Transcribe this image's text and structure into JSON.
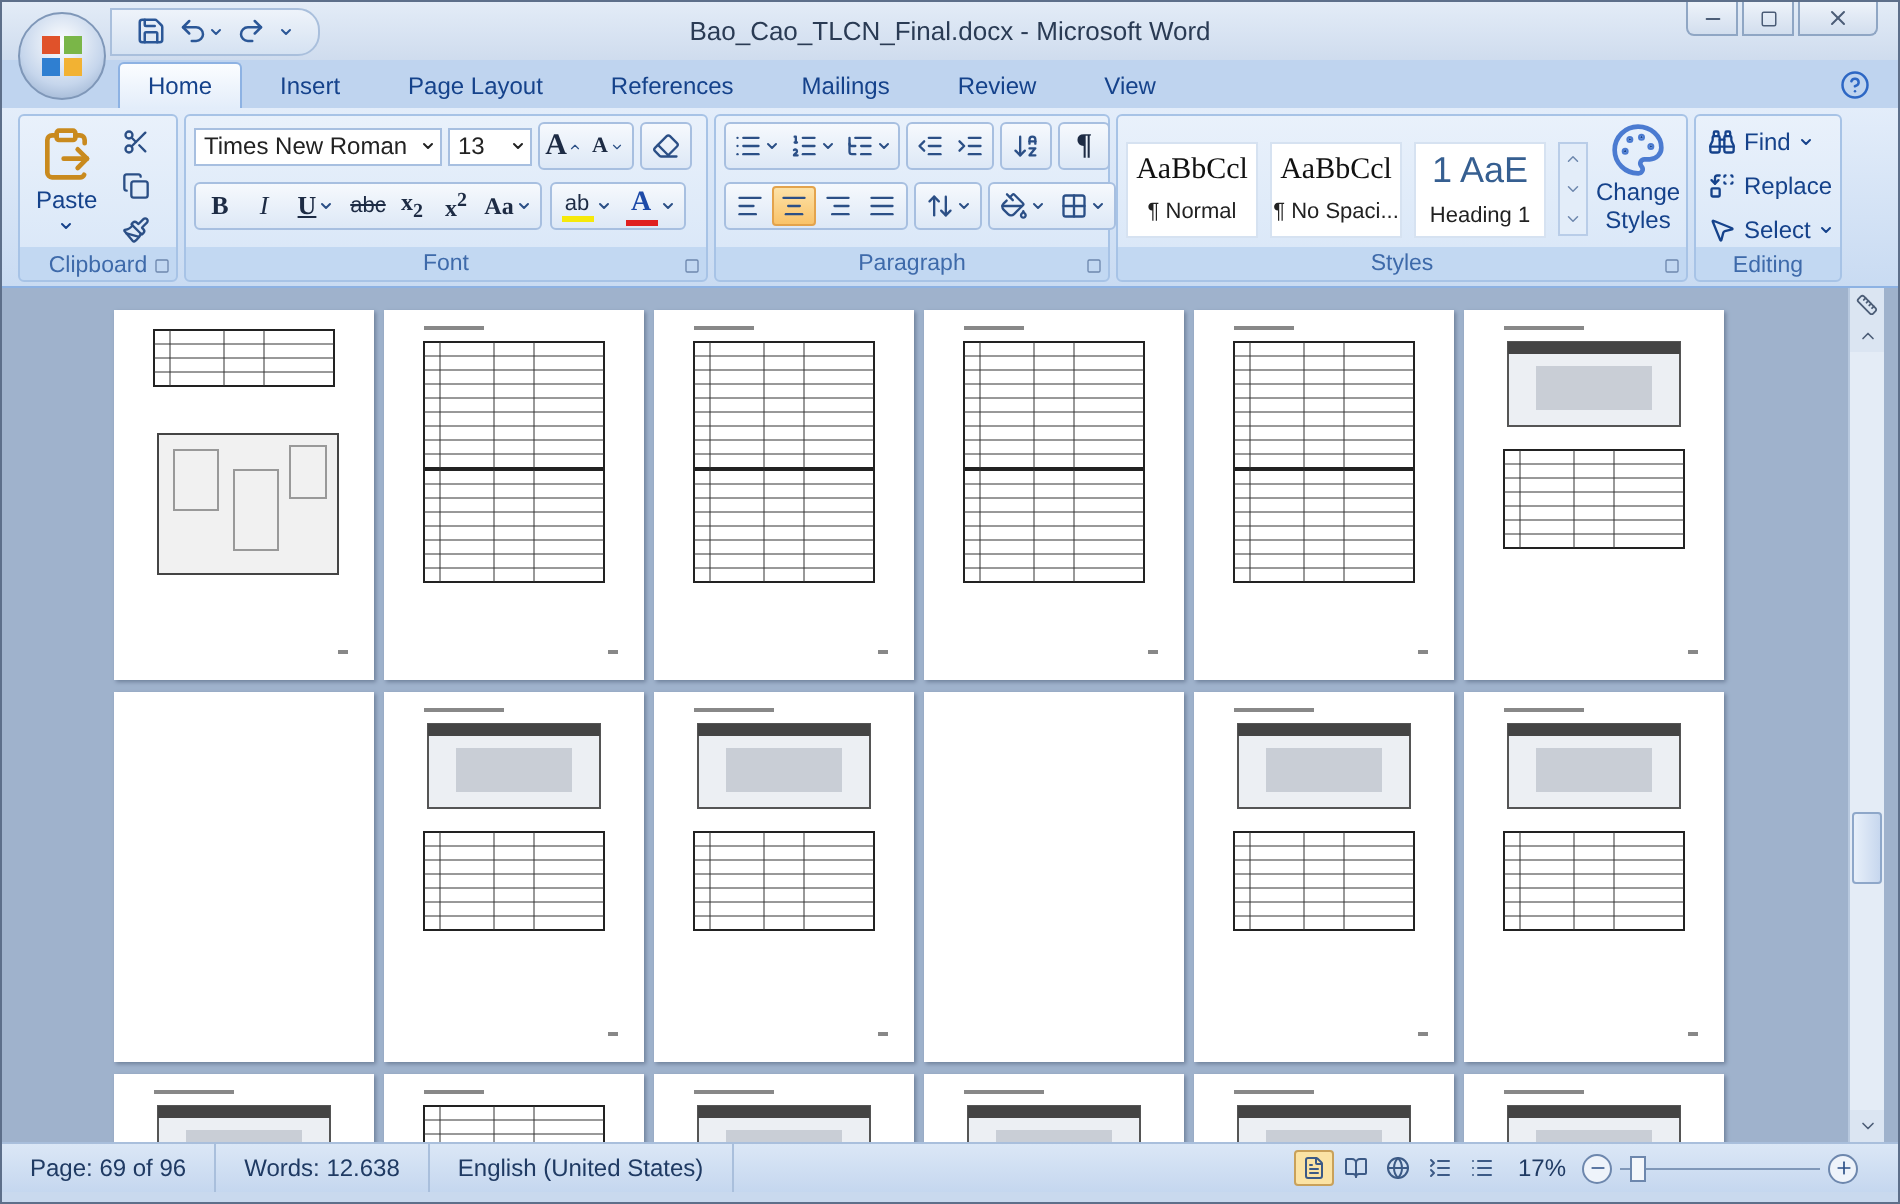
{
  "window": {
    "title": "Bao_Cao_TLCN_Final.docx - Microsoft Word"
  },
  "tabs": [
    {
      "label": "Home",
      "selected": true
    },
    {
      "label": "Insert",
      "selected": false
    },
    {
      "label": "Page Layout",
      "selected": false
    },
    {
      "label": "References",
      "selected": false
    },
    {
      "label": "Mailings",
      "selected": false
    },
    {
      "label": "Review",
      "selected": false
    },
    {
      "label": "View",
      "selected": false
    }
  ],
  "clipboard": {
    "group_label": "Clipboard",
    "paste_label": "Paste"
  },
  "font": {
    "group_label": "Font",
    "font_name": "Times New Roman",
    "font_size": "13",
    "grow_label": "A",
    "shrink_label": "A",
    "highlight_label": "ab",
    "color_label": "A",
    "format_buttons": [
      {
        "kind": "bold",
        "label": "B",
        "dropdown": false
      },
      {
        "kind": "italic",
        "label": "I",
        "dropdown": false
      },
      {
        "kind": "underline",
        "label": "U",
        "dropdown": true
      },
      {
        "kind": "strike",
        "label": "abc",
        "dropdown": false
      },
      {
        "kind": "plain",
        "label": "x$_{2}$",
        "dropdown": false
      },
      {
        "kind": "plain",
        "label": "x$^{2}$",
        "dropdown": false
      },
      {
        "kind": "plain",
        "label": "Aa",
        "dropdown": true
      }
    ]
  },
  "paragraph": {
    "group_label": "Paragraph",
    "show_marks_label": "¶",
    "alignments": [
      {
        "kind": "left",
        "selected": false
      },
      {
        "kind": "center",
        "selected": true
      },
      {
        "kind": "right",
        "selected": false
      },
      {
        "kind": "justify",
        "selected": false
      }
    ]
  },
  "styles": {
    "group_label": "Styles",
    "change_label": "Change Styles",
    "items": [
      {
        "kind": "body",
        "preview": "AaBbCcl",
        "name": "¶ Normal"
      },
      {
        "kind": "body",
        "preview": "AaBbCcl",
        "name": "¶ No Spaci..."
      },
      {
        "kind": "heading",
        "preview": "1  AaE",
        "name": "Heading 1"
      }
    ]
  },
  "editing": {
    "group_label": "Editing",
    "items": [
      {
        "kind": "find",
        "label": "Find",
        "dropdown": true
      },
      {
        "kind": "replace",
        "label": "Replace",
        "dropdown": false
      },
      {
        "kind": "select",
        "label": "Select",
        "dropdown": true
      }
    ]
  },
  "pages": [
    {
      "kind": "diagram"
    },
    {
      "kind": "tables"
    },
    {
      "kind": "tables"
    },
    {
      "kind": "tables"
    },
    {
      "kind": "tables"
    },
    {
      "kind": "screenshot"
    },
    {
      "kind": "blank"
    },
    {
      "kind": "screenshot"
    },
    {
      "kind": "screenshot"
    },
    {
      "kind": "blank"
    },
    {
      "kind": "screenshot"
    },
    {
      "kind": "screenshot"
    },
    {
      "kind": "screenshot"
    },
    {
      "kind": "tables"
    },
    {
      "kind": "screenshot"
    },
    {
      "kind": "screenshot"
    },
    {
      "kind": "screenshot"
    },
    {
      "kind": "screenshot"
    }
  ],
  "status_bar": {
    "page": "Page: 69 of 96",
    "words": "Words: 12.638",
    "language": "English (United States)",
    "views": [
      {
        "kind": "print",
        "selected": true
      },
      {
        "kind": "reading",
        "selected": false
      },
      {
        "kind": "web",
        "selected": false
      },
      {
        "kind": "outline",
        "selected": false
      },
      {
        "kind": "draft",
        "selected": false
      }
    ],
    "zoom": "17%",
    "zoom_slider": {
      "level": 0.09
    }
  }
}
